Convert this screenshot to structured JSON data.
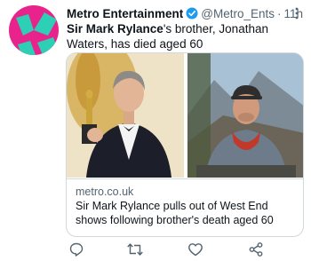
{
  "tweet": {
    "author_name": "Metro Entertainment",
    "handle": "@Metro_Ents",
    "separator": "·",
    "time": "11h",
    "text_bold": "Sir Mark Rylance",
    "text_rest": "'s brother, Jonathan Waters, has died aged 60"
  },
  "card": {
    "domain": "metro.co.uk",
    "title": "Sir Mark Rylance pulls out of West End shows following brother's death aged 60"
  },
  "icons": {
    "verified": "verified-badge-icon",
    "more": "more-options-icon",
    "reply": "reply-icon",
    "retweet": "retweet-icon",
    "like": "like-icon",
    "share": "share-icon"
  },
  "colors": {
    "accent": "#1d9bf0",
    "secondary_text": "#536471",
    "avatar_pink": "#e8248c",
    "avatar_teal": "#2dcfb5"
  }
}
